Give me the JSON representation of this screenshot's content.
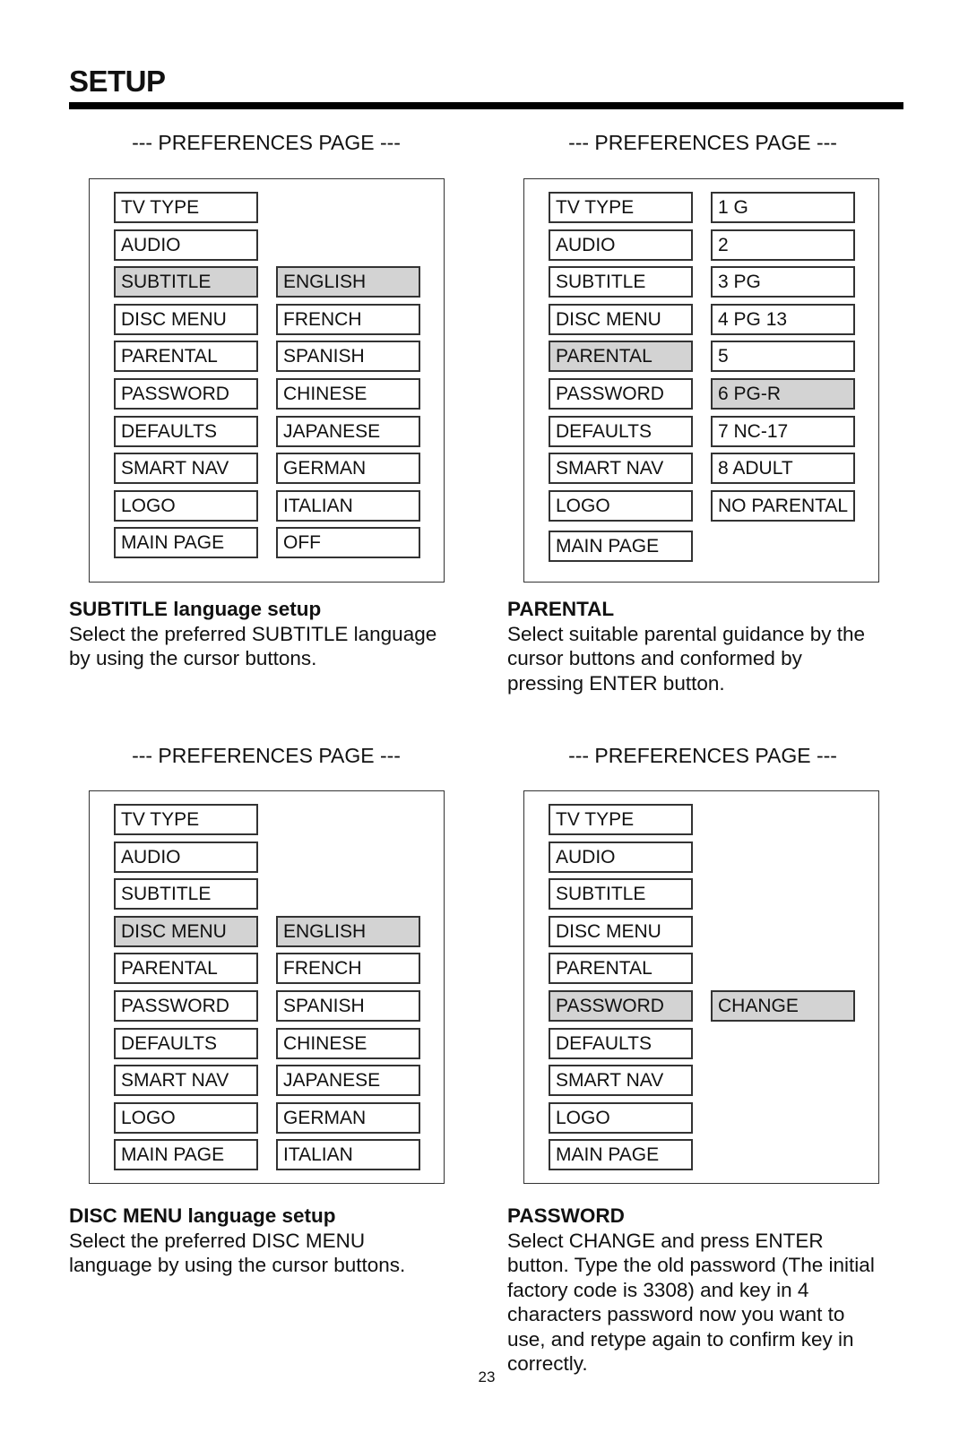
{
  "page": {
    "title": "SETUP",
    "page_number": "23",
    "highlight_color": "#d3d3d3"
  },
  "panels": [
    {
      "header": "--- PREFERENCES PAGE ---",
      "menu": [
        "TV TYPE",
        "AUDIO",
        "SUBTITLE",
        "DISC MENU",
        "PARENTAL",
        "PASSWORD",
        "DEFAULTS",
        "SMART NAV",
        "LOGO",
        "MAIN PAGE"
      ],
      "selected_menu": "SUBTITLE",
      "options_start_row": 2,
      "options": [
        "ENGLISH",
        "FRENCH",
        "SPANISH",
        "CHINESE",
        "JAPANESE",
        "GERMAN",
        "ITALIAN",
        "OFF"
      ],
      "selected_option": "ENGLISH",
      "caption_title": "SUBTITLE language setup",
      "caption_body": "Select the preferred SUBTITLE language\nby using the cursor buttons."
    },
    {
      "header": "--- PREFERENCES PAGE ---",
      "menu": [
        "TV TYPE",
        "AUDIO",
        "SUBTITLE",
        "DISC MENU",
        "PARENTAL",
        "PASSWORD",
        "DEFAULTS",
        "SMART NAV",
        "LOGO",
        "MAIN PAGE"
      ],
      "selected_menu": "PARENTAL",
      "options_start_row": 0,
      "options": [
        "1 G",
        "2",
        "3 PG",
        "4 PG 13",
        "5",
        "6 PG-R",
        "7 NC-17",
        "8 ADULT",
        "NO PARENTAL"
      ],
      "selected_option": "6 PG-R",
      "caption_title": "PARENTAL",
      "caption_body": "Select suitable parental guidance by the\ncursor buttons and conformed by\npressing ENTER button."
    },
    {
      "header": "--- PREFERENCES PAGE ---",
      "menu": [
        "TV TYPE",
        "AUDIO",
        "SUBTITLE",
        "DISC MENU",
        "PARENTAL",
        "PASSWORD",
        "DEFAULTS",
        "SMART NAV",
        "LOGO",
        "MAIN PAGE"
      ],
      "selected_menu": "DISC MENU",
      "options_start_row": 3,
      "options": [
        "ENGLISH",
        "FRENCH",
        "SPANISH",
        "CHINESE",
        "JAPANESE",
        "GERMAN",
        "ITALIAN"
      ],
      "selected_option": "ENGLISH",
      "caption_title": "DISC MENU language setup",
      "caption_body": "Select the preferred DISC MENU\nlanguage by using the cursor buttons."
    },
    {
      "header": "--- PREFERENCES PAGE ---",
      "menu": [
        "TV TYPE",
        "AUDIO",
        "SUBTITLE",
        "DISC MENU",
        "PARENTAL",
        "PASSWORD",
        "DEFAULTS",
        "SMART NAV",
        "LOGO",
        "MAIN PAGE"
      ],
      "selected_menu": "PASSWORD",
      "options_start_row": 5,
      "options": [
        "CHANGE"
      ],
      "selected_option": "CHANGE",
      "caption_title": "PASSWORD",
      "caption_body": "Select CHANGE and press ENTER\nbutton.  Type the old password (The initial\nfactory code is 3308) and key in 4\ncharacters password now you want to\nuse, and retype again to confirm key in\ncorrectly."
    }
  ]
}
